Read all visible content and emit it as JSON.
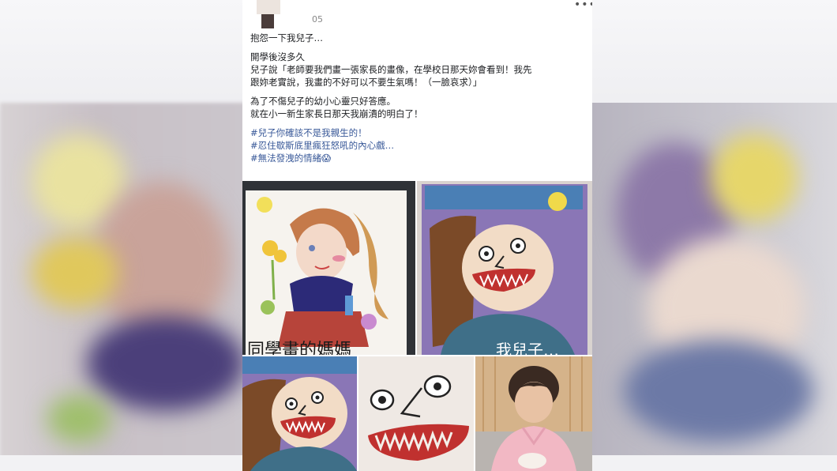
{
  "post": {
    "timestamp": "05",
    "more_label": "•••",
    "lines": [
      "抱怨一下我兒子…",
      "開學後沒多久",
      "兒子說「老師要我們畫一張家長的畫像，在學校日那天妳會看到！我先",
      "跟妳老實說，我畫的不好可以不要生氣嗎！（一臉哀求）」",
      "為了不傷兒子的幼小心靈只好答應。",
      "就在小一新生家長日那天我崩潰的明白了！"
    ],
    "hashtags": [
      "#兒子你確該不是我親生的！",
      "#忍住歇斯底里瘋狂怒吼的內心戲…",
      "#無法發洩的情緒😱"
    ]
  },
  "photos": {
    "classmate_caption": "同學畫的媽媽",
    "my_caption": "我兒子…"
  },
  "colors": {
    "link": "#385898",
    "text": "#1c1e21",
    "card": "#ffffff"
  }
}
